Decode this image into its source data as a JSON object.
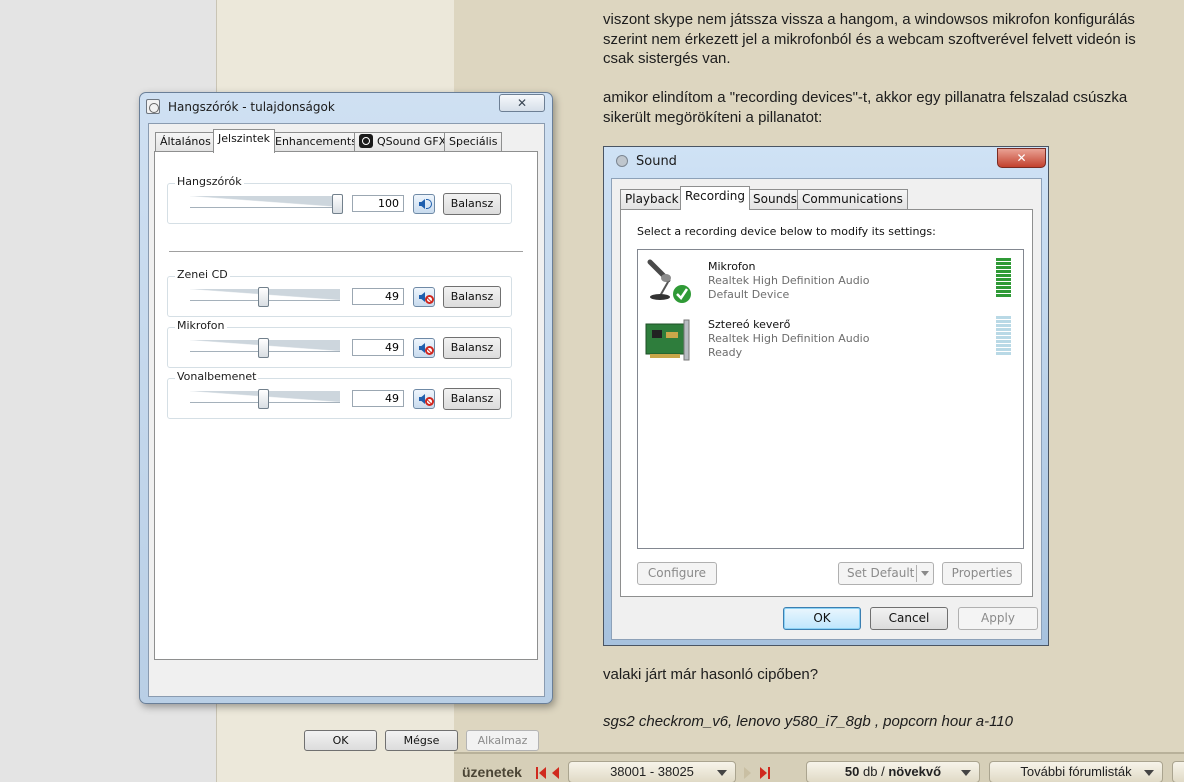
{
  "post": {
    "line1": "viszont skype nem játssza vissza a hangom, a windowsos mikrofon konfigurálás",
    "line2": "szerint nem érkezett jel a mikrofonból és a webcam szoftverével felvett videón is",
    "line3": "csak sistergés van.",
    "line4": "amikor elindítom a \"recording devices\"-t, akkor egy pillanatra felszalad csúszka",
    "line5": "sikerült megörökíteni a pillanatot:",
    "question": "valaki járt már hasonló cipőben?",
    "signature": "sgs2 checkrom_v6, lenovo y580_i7_8gb , popcorn hour a-110"
  },
  "speaker_dialog": {
    "title": "Hangszórók - tulajdonságok",
    "close_label": "✕",
    "tabs": [
      {
        "label": "Általános"
      },
      {
        "label": "Jelszintek"
      },
      {
        "label": "Enhancements"
      },
      {
        "label": "QSound GFX"
      },
      {
        "label": "Speciális"
      }
    ],
    "active_tab": "Jelszintek",
    "groups": [
      {
        "label": "Hangszórók",
        "value": "100",
        "level_percent": 100,
        "muted": false,
        "balance_label": "Balansz"
      },
      {
        "label": "Zenei CD",
        "value": "49",
        "level_percent": 49,
        "muted": true,
        "balance_label": "Balansz"
      },
      {
        "label": "Mikrofon",
        "value": "49",
        "level_percent": 49,
        "muted": true,
        "balance_label": "Balansz"
      },
      {
        "label": "Vonalbemenet",
        "value": "49",
        "level_percent": 49,
        "muted": true,
        "balance_label": "Balansz"
      }
    ],
    "buttons": {
      "ok": "OK",
      "cancel": "Mégse",
      "apply": "Alkalmaz"
    }
  },
  "sound_dialog": {
    "title": "Sound",
    "close_label": "✕",
    "tabs": [
      {
        "label": "Playback"
      },
      {
        "label": "Recording"
      },
      {
        "label": "Sounds"
      },
      {
        "label": "Communications"
      }
    ],
    "active_tab": "Recording",
    "instruction": "Select a recording device below to modify its settings:",
    "devices": [
      {
        "name": "Mikrofon",
        "driver": "Realtek High Definition Audio",
        "status": "Default Device",
        "level_bars_lit": 10,
        "level_bars_total": 10,
        "icon": "microphone-icon"
      },
      {
        "name": "Sztereó keverő",
        "driver": "Realtek High Definition Audio",
        "status": "Ready",
        "level_bars_lit": 0,
        "level_bars_total": 10,
        "icon": "sound-card-icon"
      }
    ],
    "buttons": {
      "configure": "Configure",
      "set_default": "Set Default",
      "properties": "Properties",
      "ok": "OK",
      "cancel": "Cancel",
      "apply": "Apply"
    },
    "colors": {
      "level_on": "#2f9a36",
      "level_off": "#b9d9e6"
    }
  },
  "navbar": {
    "label": "üzenetek",
    "range_select": "38001 - 38025",
    "count_select_num": "50",
    "count_select_rest": " db / ",
    "count_select_order": "növekvő",
    "forum_lists": "További fórumlisták",
    "arrow_color": "#d02a1e"
  }
}
